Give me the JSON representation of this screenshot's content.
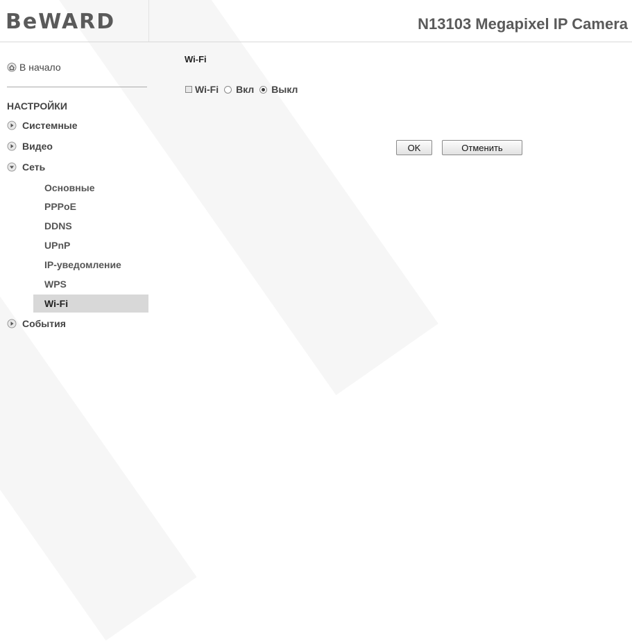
{
  "header": {
    "logo": "BeWARD",
    "camera_title": "N13103 Megapixel IP Camera"
  },
  "sidebar": {
    "home_label": "В начало",
    "section_title": "НАСТРОЙКИ",
    "items": [
      {
        "label": "Системные",
        "expanded": false
      },
      {
        "label": "Видео",
        "expanded": false
      },
      {
        "label": "Сеть",
        "expanded": true
      },
      {
        "label": "События",
        "expanded": false
      }
    ],
    "network_subitems": [
      "Основные",
      "PPPoE",
      "DDNS",
      "UPnP",
      "IP-уведомление",
      "WPS",
      "Wi-Fi"
    ],
    "active_subitem": "Wi-Fi"
  },
  "main": {
    "title": "Wi-Fi",
    "wifi_label": "Wi-Fi",
    "options": [
      {
        "label": "Вкл",
        "selected": false
      },
      {
        "label": "Выкл",
        "selected": true
      }
    ],
    "ok_label": "OK",
    "cancel_label": "Отменить"
  }
}
